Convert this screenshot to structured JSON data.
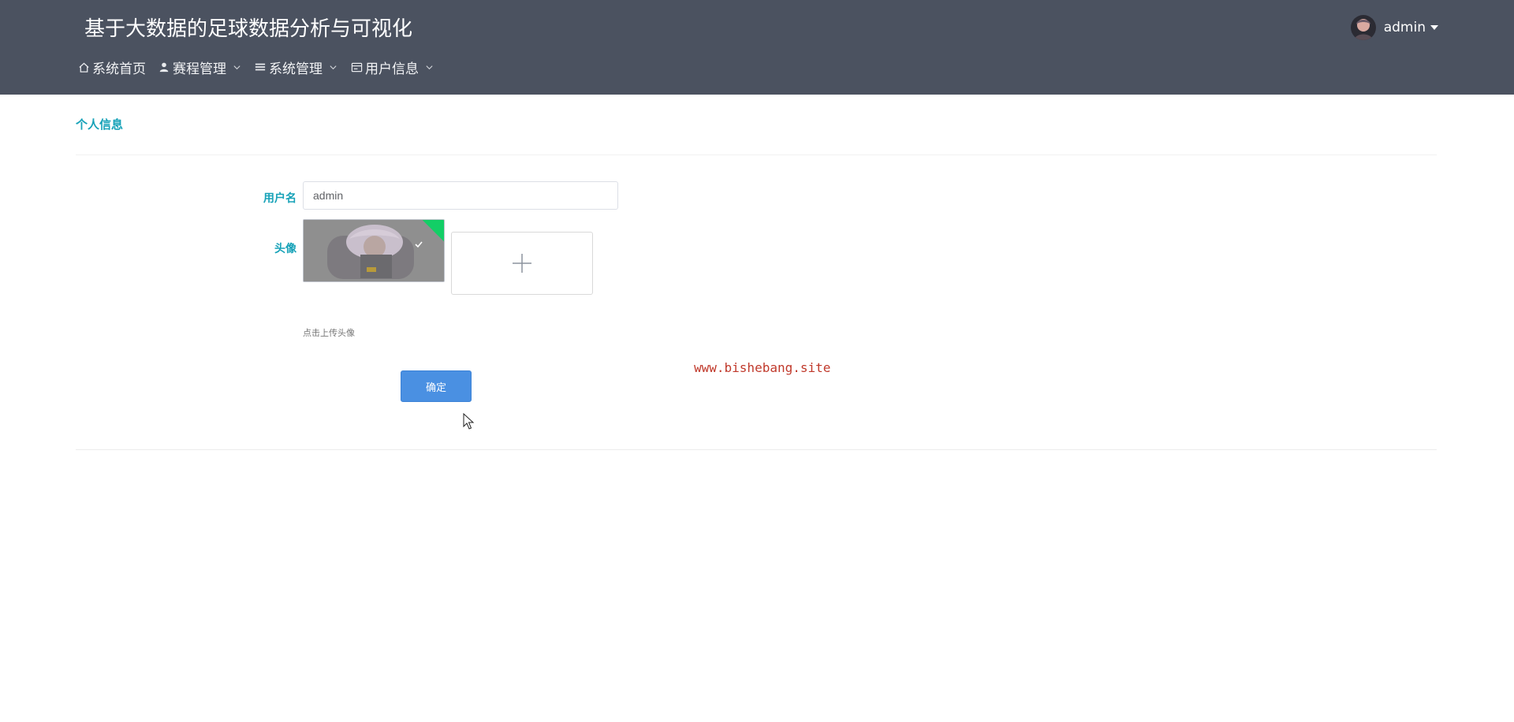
{
  "app": {
    "title": "基于大数据的足球数据分析与可视化"
  },
  "nav": {
    "items": [
      {
        "label": "系统首页",
        "icon": "home-icon",
        "has_dropdown": false
      },
      {
        "label": "赛程管理",
        "icon": "user-icon",
        "has_dropdown": true
      },
      {
        "label": "系统管理",
        "icon": "list-icon",
        "has_dropdown": true
      },
      {
        "label": "用户信息",
        "icon": "card-icon",
        "has_dropdown": true
      }
    ]
  },
  "user": {
    "name": "admin"
  },
  "page": {
    "breadcrumb": "个人信息"
  },
  "form": {
    "username_label": "用户名",
    "username_value": "admin",
    "avatar_label": "头像",
    "upload_hint": "点击上传头像",
    "confirm_label": "确定"
  },
  "watermark": "www.bishebang.site",
  "colors": {
    "header_bg": "#4b5260",
    "accent": "#17a2b8",
    "primary_button": "#4a90e2",
    "success_badge": "#13ce66",
    "watermark": "#c0392b"
  }
}
